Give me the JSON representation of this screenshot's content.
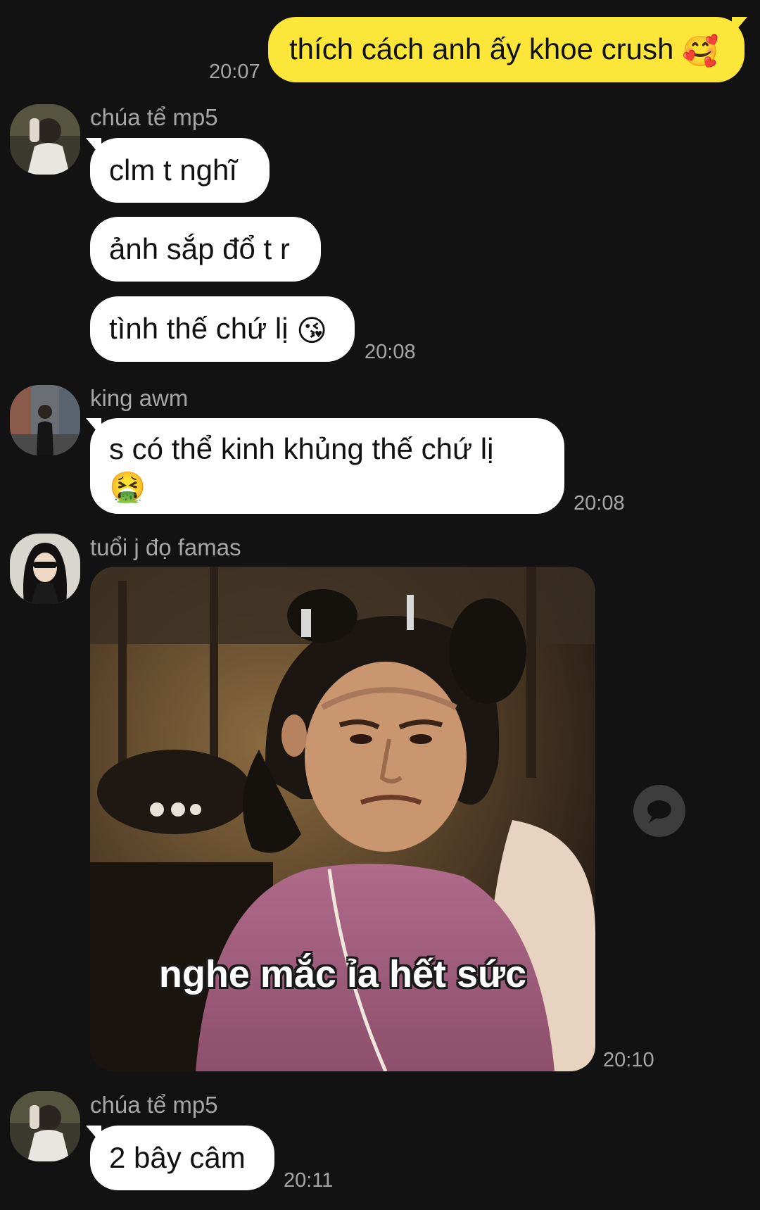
{
  "messages": {
    "m1": {
      "text": "thích cách anh ấy khoe crush",
      "emoji": "🥰",
      "time": "20:07"
    },
    "g1": {
      "sender": "chúa tể mp5",
      "b1": "clm t nghĩ",
      "b2": "ảnh sắp đổ t r",
      "b3": "tình thế chứ lị",
      "b3_emoji": "😘",
      "time": "20:08"
    },
    "g2": {
      "sender": "king awm",
      "line1": "s có thể kinh khủng thế chứ lị",
      "emoji": "🤮",
      "time": "20:08"
    },
    "g3": {
      "sender": "tuổi j đọ famas",
      "meme_caption": "nghe mắc ỉa hết sức",
      "time": "20:10"
    },
    "g4": {
      "sender": "chúa tể mp5",
      "b1": "2 bây câm",
      "time": "20:11"
    }
  },
  "icons": {
    "reply": "speech-bubble-icon"
  },
  "colors": {
    "background": "#121212",
    "outgoing_bubble": "#fce63a",
    "incoming_bubble": "#ffffff",
    "meta_text": "#a6a6a6"
  }
}
